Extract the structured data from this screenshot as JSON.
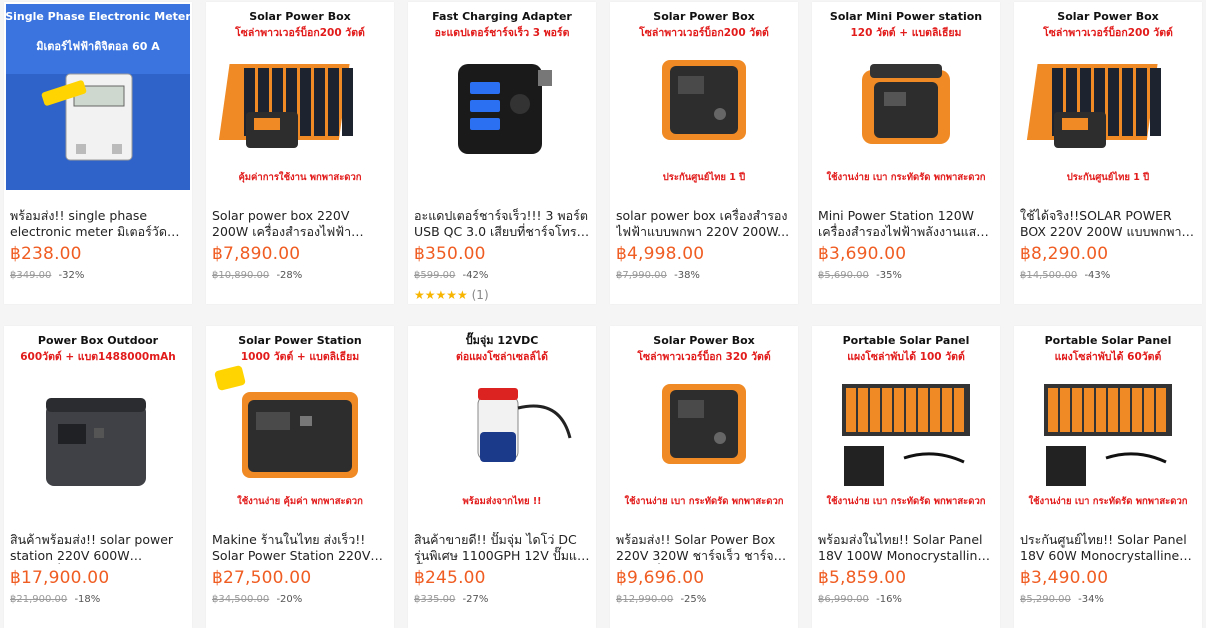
{
  "colors": {
    "price": "#f05d23",
    "card_bg": "#ffffff",
    "page_bg": "#f5f5f5",
    "star": "#f7b500"
  },
  "products": [
    {
      "banner_top": "Single Phase Electronic Meter",
      "banner_sub": "มิเตอร์ไฟฟ้าดิจิตอล 60 A",
      "banner_tag": "",
      "title": "พร้อมส่ง!! single phase electronic meter มิเตอร์วัดการใ...",
      "price": "฿238.00",
      "old_price": "฿349.00",
      "discount": "-32%",
      "rating": null
    },
    {
      "banner_top": "Solar Power Box",
      "banner_sub": "โซล่าพาวเวอร์บ็อก200 วัตต์",
      "banner_tag": "คุ้มค่าการใช้งาน พกพาสะดวก",
      "title": "Solar power box 220V 200W เครื่องสำรองไฟฟ้าพลังงานแสง...",
      "price": "฿7,890.00",
      "old_price": "฿10,890.00",
      "discount": "-28%",
      "rating": null
    },
    {
      "banner_top": "Fast Charging Adapter",
      "banner_sub": "อะแดปเตอร์ชาร์จเร็ว 3 พอร์ต",
      "banner_tag": "",
      "title": "อะแดปเตอร์ชาร์จเร็ว!!! 3 พอร์ต USB QC 3.0 เสียบที่ชาร์จโทรศัพ...",
      "price": "฿350.00",
      "old_price": "฿599.00",
      "discount": "-42%",
      "rating": {
        "stars": "★★★★★",
        "count": "(1)"
      }
    },
    {
      "banner_top": "Solar Power Box",
      "banner_sub": "โซล่าพาวเวอร์บ็อก200 วัตต์",
      "banner_tag": "ประกันศูนย์ไทย 1 ปี",
      "title": "solar power box เครื่องสำรองไฟฟ้าแบบพกพา 220V 200W...",
      "price": "฿4,998.00",
      "old_price": "฿7,990.00",
      "discount": "-38%",
      "rating": null
    },
    {
      "banner_top": "Solar Mini Power station",
      "banner_sub": "120 วัตต์ + แบตลิเธียม",
      "banner_tag": "ใช้งานง่าย เบา กระทัดรัด พกพาสะดวก",
      "title": "Mini Power Station 120W เครื่องสำรองไฟฟ้าพลังงานแสงอาทิตย์...",
      "price": "฿3,690.00",
      "old_price": "฿5,690.00",
      "discount": "-35%",
      "rating": null
    },
    {
      "banner_top": "Solar Power Box",
      "banner_sub": "โซล่าพาวเวอร์บ็อก200 วัตต์",
      "banner_tag": "ประกันศูนย์ไทย 1 ปี",
      "title": "ใช้ได้จริง!!SOLAR POWER BOX 220V 200W แบบพกพา 173Wh...",
      "price": "฿8,290.00",
      "old_price": "฿14,500.00",
      "discount": "-43%",
      "rating": null
    },
    {
      "banner_top": "Power Box Outdoor",
      "banner_sub": "600วัตต์ + แบต1488000mAh",
      "banner_tag": "",
      "title": "สินค้าพร้อมส่ง!! solar power station 220V 600W แบตเตอรี่...",
      "price": "฿17,900.00",
      "old_price": "฿21,900.00",
      "discount": "-18%",
      "rating": null
    },
    {
      "banner_top": "Solar Power Station",
      "banner_sub": "1000 วัตต์ + แบตลิเธียม",
      "banner_tag": "ใช้งานง่าย คุ้มค่า พกพาสะดวก",
      "title": "Makine ร้านในไทย ส่งเร็ว!! Solar Power Station 220V 1000W...",
      "price": "฿27,500.00",
      "old_price": "฿34,500.00",
      "discount": "-20%",
      "rating": null
    },
    {
      "banner_top": "ปั๊มจุ่ม 12VDC",
      "banner_sub": "ต่อแผงโซล่าเซลล์ได้",
      "banner_tag": "พร้อมส่งจากไทย !!",
      "title": "สินค้าขายดี!! ปั๊มจุ่ม ไดโว่ DC รุ่นพิเศษ 1100GPH 12V ปั๊มแช่ ปั๊ม...",
      "price": "฿245.00",
      "old_price": "฿335.00",
      "discount": "-27%",
      "rating": null
    },
    {
      "banner_top": "Solar Power Box",
      "banner_sub": "โซล่าพาวเวอร์บ็อก 320 วัตต์",
      "banner_tag": "ใช้งานง่าย เบา กระทัดรัด พกพาสะดวก",
      "title": "พร้อมส่ง!! Solar Power Box 220V 320W ชาร์จเร็ว ชาร์จไร้สาย เครื่อ...",
      "price": "฿9,696.00",
      "old_price": "฿12,990.00",
      "discount": "-25%",
      "rating": null
    },
    {
      "banner_top": "Portable Solar Panel",
      "banner_sub": "แผงโซล่าพับได้ 100 วัตต์",
      "banner_tag": "ใช้งานง่าย เบา กระทัดรัด พกพาสะดวก",
      "title": "พร้อมส่งในไทย!! Solar Panel 18V 100W Monocrystalline แผงเซล...",
      "price": "฿5,859.00",
      "old_price": "฿6,990.00",
      "discount": "-16%",
      "rating": null
    },
    {
      "banner_top": "Portable Solar Panel",
      "banner_sub": "แผงโซล่าพับได้ 60วัตต์",
      "banner_tag": "ใช้งานง่าย เบา กระทัดรัด พกพาสะดวก",
      "title": "ประกันศูนย์ไทย!! Solar Panel 18V 60W Monocrystalline แผงเซลล์...",
      "price": "฿3,490.00",
      "old_price": "฿5,290.00",
      "discount": "-34%",
      "rating": null
    }
  ]
}
